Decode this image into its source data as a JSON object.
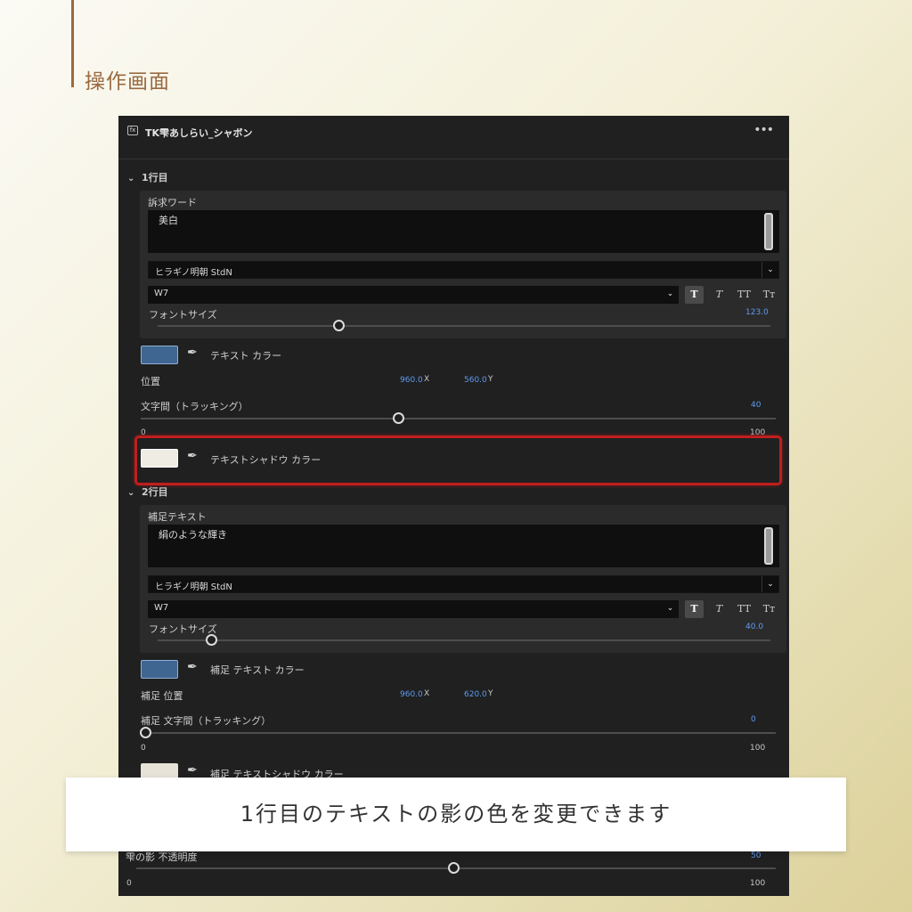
{
  "page_heading": "操作画面",
  "panel": {
    "title": "TK雫あしらい_シャボン",
    "more": "•••"
  },
  "section1": {
    "header": "1行目",
    "appeal_label": "訴求ワード",
    "appeal_text": "美白",
    "font_family": "ヒラギノ明朝 StdN",
    "font_weight": "W7",
    "style_buttons": [
      "T",
      "T",
      "TT",
      "Tт"
    ],
    "font_size_label": "フォントサイズ",
    "font_size_value": "123.0",
    "text_color_label": "テキスト カラー",
    "text_color": "#3f6690",
    "position_label": "位置",
    "position_x": "960.0",
    "position_y": "560.0",
    "x_unit": "X",
    "y_unit": "Y",
    "tracking_label": "文字間（トラッキング）",
    "tracking_value": "40",
    "tracking_min": "0",
    "tracking_max": "100",
    "shadow_color_label": "テキストシャドウ カラー",
    "shadow_color": "#efece3"
  },
  "section2": {
    "header": "2行目",
    "sub_label": "補足テキスト",
    "sub_text": "絹のような輝き",
    "font_family": "ヒラギノ明朝 StdN",
    "font_weight": "W7",
    "style_buttons": [
      "T",
      "T",
      "TT",
      "Tт"
    ],
    "font_size_label": "フォントサイズ",
    "font_size_value": "40.0",
    "text_color_label": "補足 テキスト カラー",
    "text_color": "#3f6690",
    "position_label": "補足 位置",
    "position_x": "960.0",
    "position_y": "620.0",
    "x_unit": "X",
    "y_unit": "Y",
    "tracking_label": "補足 文字間（トラッキング）",
    "tracking_value": "0",
    "tracking_min": "0",
    "tracking_max": "100",
    "shadow_color_label": "補足 テキストシャドウ カラー",
    "shadow_color": "#e6e2d8"
  },
  "drop": {
    "opacity_label": "雫の影 不透明度",
    "opacity_value": "50",
    "min": "0",
    "max": "100"
  },
  "caption": "1行目のテキストの影の色を変更できます",
  "highlight_color": "#c01e1e"
}
